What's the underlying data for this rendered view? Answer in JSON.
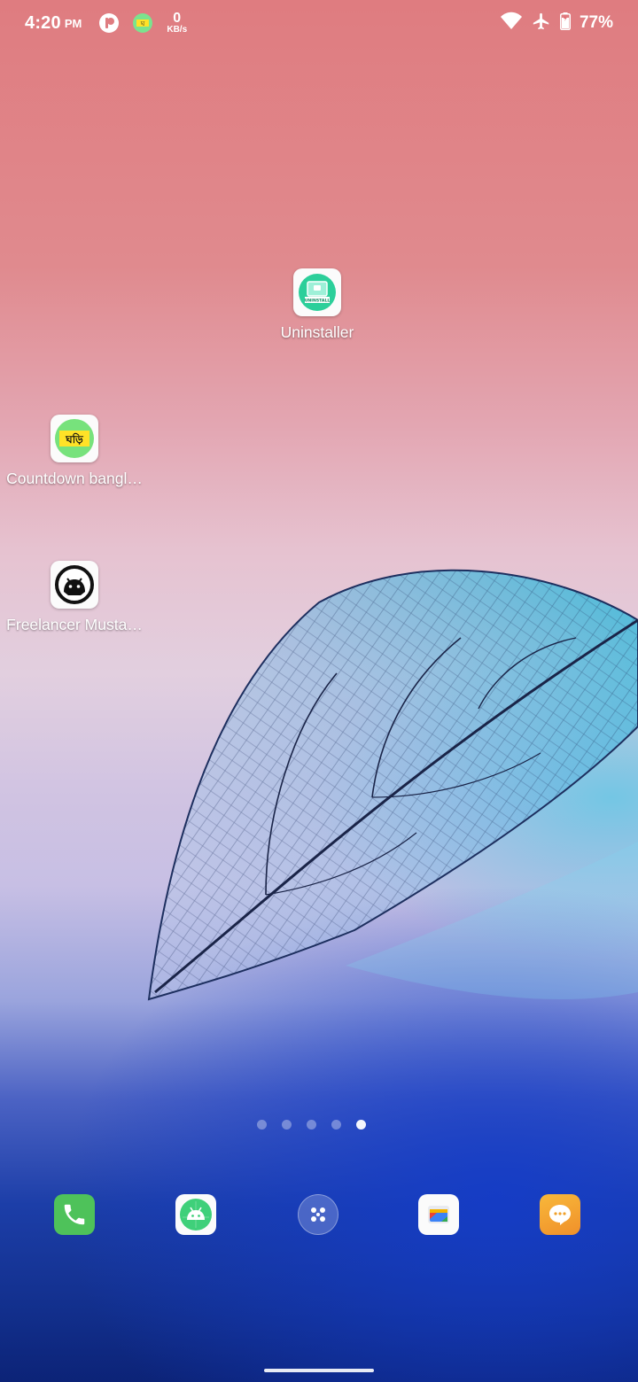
{
  "status_bar": {
    "time": "4:20",
    "ampm": "PM",
    "net_speed_value": "0",
    "net_speed_unit": "KB/s",
    "battery_percent": "77%",
    "icons": [
      "app-indicator-icon",
      "ghori-app-icon",
      "wifi-icon",
      "airplane-mode-icon",
      "battery-icon"
    ]
  },
  "home": {
    "apps": [
      {
        "label": "Uninstaller",
        "icon": "uninstaller-icon",
        "icon_text": "UNINSTALL"
      },
      {
        "label": "Countdown bangl…",
        "icon": "countdown-icon",
        "icon_text": "ঘড়ি"
      },
      {
        "label": "Freelancer Musta…",
        "icon": "android-dev-icon"
      }
    ],
    "page_indicator": {
      "pages": 5,
      "active_page": 5
    }
  },
  "dock": {
    "items": [
      "phone-icon",
      "android-app-icon",
      "app-drawer-icon",
      "gallery-icon",
      "messages-icon"
    ]
  },
  "colors": {
    "phone_green": "#4ec25a",
    "message_orange": "#f5a02a",
    "uninstall_teal": "#2ccf9a"
  }
}
